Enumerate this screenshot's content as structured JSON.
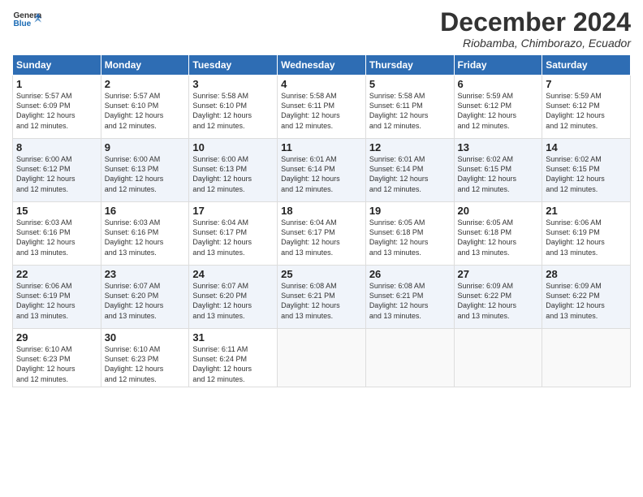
{
  "logo": {
    "line1": "General",
    "line2": "Blue"
  },
  "title": "December 2024",
  "subtitle": "Riobamba, Chimborazo, Ecuador",
  "days_of_week": [
    "Sunday",
    "Monday",
    "Tuesday",
    "Wednesday",
    "Thursday",
    "Friday",
    "Saturday"
  ],
  "weeks": [
    [
      {
        "day": "1",
        "sunrise": "5:57 AM",
        "sunset": "6:09 PM",
        "daylight": "12 hours and 12 minutes."
      },
      {
        "day": "2",
        "sunrise": "5:57 AM",
        "sunset": "6:10 PM",
        "daylight": "12 hours and 12 minutes."
      },
      {
        "day": "3",
        "sunrise": "5:58 AM",
        "sunset": "6:10 PM",
        "daylight": "12 hours and 12 minutes."
      },
      {
        "day": "4",
        "sunrise": "5:58 AM",
        "sunset": "6:11 PM",
        "daylight": "12 hours and 12 minutes."
      },
      {
        "day": "5",
        "sunrise": "5:58 AM",
        "sunset": "6:11 PM",
        "daylight": "12 hours and 12 minutes."
      },
      {
        "day": "6",
        "sunrise": "5:59 AM",
        "sunset": "6:12 PM",
        "daylight": "12 hours and 12 minutes."
      },
      {
        "day": "7",
        "sunrise": "5:59 AM",
        "sunset": "6:12 PM",
        "daylight": "12 hours and 12 minutes."
      }
    ],
    [
      {
        "day": "8",
        "sunrise": "6:00 AM",
        "sunset": "6:12 PM",
        "daylight": "12 hours and 12 minutes."
      },
      {
        "day": "9",
        "sunrise": "6:00 AM",
        "sunset": "6:13 PM",
        "daylight": "12 hours and 12 minutes."
      },
      {
        "day": "10",
        "sunrise": "6:00 AM",
        "sunset": "6:13 PM",
        "daylight": "12 hours and 12 minutes."
      },
      {
        "day": "11",
        "sunrise": "6:01 AM",
        "sunset": "6:14 PM",
        "daylight": "12 hours and 12 minutes."
      },
      {
        "day": "12",
        "sunrise": "6:01 AM",
        "sunset": "6:14 PM",
        "daylight": "12 hours and 12 minutes."
      },
      {
        "day": "13",
        "sunrise": "6:02 AM",
        "sunset": "6:15 PM",
        "daylight": "12 hours and 12 minutes."
      },
      {
        "day": "14",
        "sunrise": "6:02 AM",
        "sunset": "6:15 PM",
        "daylight": "12 hours and 12 minutes."
      }
    ],
    [
      {
        "day": "15",
        "sunrise": "6:03 AM",
        "sunset": "6:16 PM",
        "daylight": "12 hours and 13 minutes."
      },
      {
        "day": "16",
        "sunrise": "6:03 AM",
        "sunset": "6:16 PM",
        "daylight": "12 hours and 13 minutes."
      },
      {
        "day": "17",
        "sunrise": "6:04 AM",
        "sunset": "6:17 PM",
        "daylight": "12 hours and 13 minutes."
      },
      {
        "day": "18",
        "sunrise": "6:04 AM",
        "sunset": "6:17 PM",
        "daylight": "12 hours and 13 minutes."
      },
      {
        "day": "19",
        "sunrise": "6:05 AM",
        "sunset": "6:18 PM",
        "daylight": "12 hours and 13 minutes."
      },
      {
        "day": "20",
        "sunrise": "6:05 AM",
        "sunset": "6:18 PM",
        "daylight": "12 hours and 13 minutes."
      },
      {
        "day": "21",
        "sunrise": "6:06 AM",
        "sunset": "6:19 PM",
        "daylight": "12 hours and 13 minutes."
      }
    ],
    [
      {
        "day": "22",
        "sunrise": "6:06 AM",
        "sunset": "6:19 PM",
        "daylight": "12 hours and 13 minutes."
      },
      {
        "day": "23",
        "sunrise": "6:07 AM",
        "sunset": "6:20 PM",
        "daylight": "12 hours and 13 minutes."
      },
      {
        "day": "24",
        "sunrise": "6:07 AM",
        "sunset": "6:20 PM",
        "daylight": "12 hours and 13 minutes."
      },
      {
        "day": "25",
        "sunrise": "6:08 AM",
        "sunset": "6:21 PM",
        "daylight": "12 hours and 13 minutes."
      },
      {
        "day": "26",
        "sunrise": "6:08 AM",
        "sunset": "6:21 PM",
        "daylight": "12 hours and 13 minutes."
      },
      {
        "day": "27",
        "sunrise": "6:09 AM",
        "sunset": "6:22 PM",
        "daylight": "12 hours and 13 minutes."
      },
      {
        "day": "28",
        "sunrise": "6:09 AM",
        "sunset": "6:22 PM",
        "daylight": "12 hours and 13 minutes."
      }
    ],
    [
      {
        "day": "29",
        "sunrise": "6:10 AM",
        "sunset": "6:23 PM",
        "daylight": "12 hours and 12 minutes."
      },
      {
        "day": "30",
        "sunrise": "6:10 AM",
        "sunset": "6:23 PM",
        "daylight": "12 hours and 12 minutes."
      },
      {
        "day": "31",
        "sunrise": "6:11 AM",
        "sunset": "6:24 PM",
        "daylight": "12 hours and 12 minutes."
      },
      null,
      null,
      null,
      null
    ]
  ]
}
